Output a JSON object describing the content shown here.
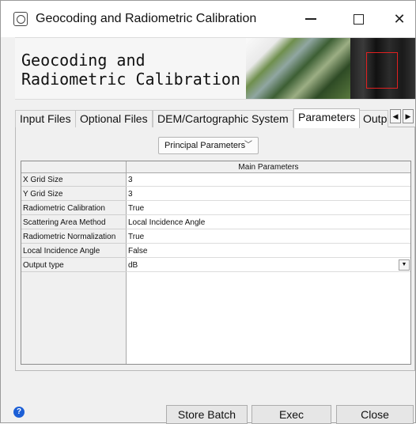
{
  "window": {
    "title": "Geocoding and Radiometric Calibration",
    "controls": {
      "minimize": "—",
      "maximize": "☐",
      "close": "✕"
    }
  },
  "banner": {
    "title": "Geocoding and Radiometric Calibration"
  },
  "tabs": [
    {
      "label": "Input Files",
      "active": false
    },
    {
      "label": "Optional Files",
      "active": false
    },
    {
      "label": "DEM/Cartographic System",
      "active": false
    },
    {
      "label": "Parameters",
      "active": true
    },
    {
      "label": "Outp",
      "active": false
    }
  ],
  "tab_scroll": {
    "left": "◀",
    "right": "▶"
  },
  "panel": {
    "selector": {
      "value": "Principal Parameters",
      "chevron": "﹀"
    }
  },
  "table": {
    "header": "Main Parameters",
    "rows": [
      {
        "label": "X Grid Size",
        "value": "3"
      },
      {
        "label": "Y Grid Size",
        "value": "3"
      },
      {
        "label": "Radiometric Calibration",
        "value": "True"
      },
      {
        "label": "Scattering Area Method",
        "value": "Local Incidence Angle"
      },
      {
        "label": "Radiometric Normalization",
        "value": "True"
      },
      {
        "label": "Local Incidence Angle",
        "value": "False"
      },
      {
        "label": "Output type",
        "value": "dB",
        "dropdown_arrow": "▼"
      }
    ]
  },
  "footer": {
    "help": "?",
    "buttons": {
      "store_batch": "Store Batch",
      "exec": "Exec",
      "close": "Close"
    }
  },
  "colors": {
    "help_icon": "#1c5fd6",
    "banner_marker": "#e02020"
  }
}
